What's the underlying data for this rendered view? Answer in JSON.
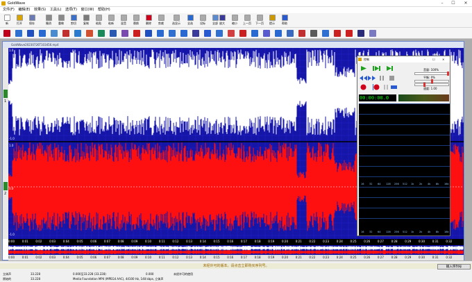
{
  "window": {
    "title": "GoldWave",
    "minimize": "–",
    "maximize": "☐",
    "close": "✕"
  },
  "menu": [
    "文件(F)",
    "编辑(E)",
    "效果(S)",
    "工具(L)",
    "选项(T)",
    "窗口(W)",
    "帮助(H)"
  ],
  "toolbar": [
    {
      "label": "新",
      "icon": "new-icon",
      "color": "#ffffff"
    },
    {
      "label": "打开",
      "icon": "open-icon",
      "color": "#d9a300"
    },
    {
      "label": "保存",
      "icon": "save-icon",
      "color": "#6a7ab5"
    },
    {
      "label": "撤消",
      "icon": "undo-icon",
      "color": "#8a8a8a"
    },
    {
      "label": "重做",
      "icon": "redo-icon",
      "color": "#8a8a8a"
    },
    {
      "label": "剪切",
      "icon": "cut-icon",
      "color": "#3a70c9"
    },
    {
      "label": "复制",
      "icon": "copy-icon",
      "color": "#7a7a7a"
    },
    {
      "label": "粘贴",
      "icon": "paste-icon",
      "color": "#aaaaaa"
    },
    {
      "label": "粘新",
      "icon": "paste-new-icon",
      "color": "#aaaaaa"
    },
    {
      "label": "混音",
      "icon": "mix-icon",
      "color": "#aaaaaa"
    },
    {
      "label": "替换",
      "icon": "replace-icon",
      "color": "#aaaaaa"
    },
    {
      "label": "删除",
      "icon": "delete-icon",
      "color": "#d0021b"
    },
    {
      "label": "剪裁",
      "icon": "trim-icon",
      "color": "#aaaaaa"
    },
    {
      "label": "选显示",
      "icon": "select-view-icon",
      "color": "#aaaaaa"
    },
    {
      "label": "全选",
      "icon": "select-all-icon",
      "color": "#2a6ad0"
    },
    {
      "label": "设标",
      "icon": "set-marker-icon",
      "color": "#aaaaaa"
    },
    {
      "label": "全部",
      "icon": "all-icon",
      "color": "#5a8ad0"
    },
    {
      "label": "放大",
      "icon": "zoom-in-icon",
      "color": "#3a3a9a"
    },
    {
      "label": "缩小",
      "icon": "zoom-out-icon",
      "color": "#aaaaaa"
    },
    {
      "label": "上一页",
      "icon": "prev-icon",
      "color": "#aaaaaa"
    },
    {
      "label": "下一页",
      "icon": "next-icon",
      "color": "#aaaaaa"
    },
    {
      "label": "提示",
      "icon": "cue-icon",
      "color": "#cc9900"
    },
    {
      "label": "帮助",
      "icon": "help-icon",
      "color": "#2a5ad0"
    }
  ],
  "effects_toolbar": [
    "#c0001a",
    "#3070d0",
    "#2050c0",
    "#2a6ad0",
    "#4a8ad0",
    "#c03030",
    "#2a7ad0",
    "#d05030",
    "#1a8a5a",
    "#2a5ab0",
    "#7a4ab0",
    "#cc2020",
    "#2050c0",
    "#2a6ad0",
    "#3070d0",
    "#2a6ad0",
    "#3a3a9a",
    "#2a5ad0",
    "#3070d0",
    "#d04040",
    "#cc2020",
    "#2a6ad0",
    "#5a5ad0",
    "#2a6ad0",
    "#3a6ac0",
    "#c03030",
    "#5a5a5a",
    "#3070d0",
    "#cc2020",
    "#cc2020",
    "#2a2a7a",
    "#7a7ac0"
  ],
  "document": {
    "title": "GoldWave20230726T103456.mp4",
    "channel_left": "1",
    "channel_right": "2",
    "scale_top": "1.0",
    "scale_mid": "0.0",
    "scale_bottom": "-1.0"
  },
  "timeline": [
    "0:00",
    "0:01",
    "0:02",
    "0:03",
    "0:04",
    "0:05",
    "0:06",
    "0:07",
    "0:08",
    "0:09",
    "0:10",
    "0:11",
    "0:12",
    "0:13",
    "0:14",
    "0:15",
    "0:16",
    "0:17",
    "0:18",
    "0:19",
    "0:20",
    "0:21",
    "0:22",
    "0:23",
    "0:24",
    "0:25",
    "0:26",
    "0:27",
    "0:28",
    "0:29",
    "0:30",
    "0:31",
    "0:32"
  ],
  "control": {
    "title": "控制",
    "volume_label": "音量: 100%",
    "balance_label": "平衡: 0%",
    "speed_label": "速度: 1.00",
    "volume": 1.0,
    "balance": 0.0,
    "speed": 1.0,
    "clock": "00:00:00.0",
    "spectrum_freqs": [
      "16",
      "32",
      "64",
      "128",
      "256",
      "512",
      "1k",
      "2k",
      "4k",
      "8k",
      "16k"
    ]
  },
  "status": {
    "banner": "未经许可的版本。请点击立即购买序列号。",
    "register_button": "输入序列号",
    "row1": [
      "立体声",
      "33.228",
      "0.000至33.228 (33.228)",
      "0.000",
      "未经许可的使用"
    ],
    "row2": [
      "原始的",
      "33.228",
      "Media Foundation MP4 (MPEG4 AAC), 44100 Hz, 148 kbps, 立体声"
    ]
  }
}
